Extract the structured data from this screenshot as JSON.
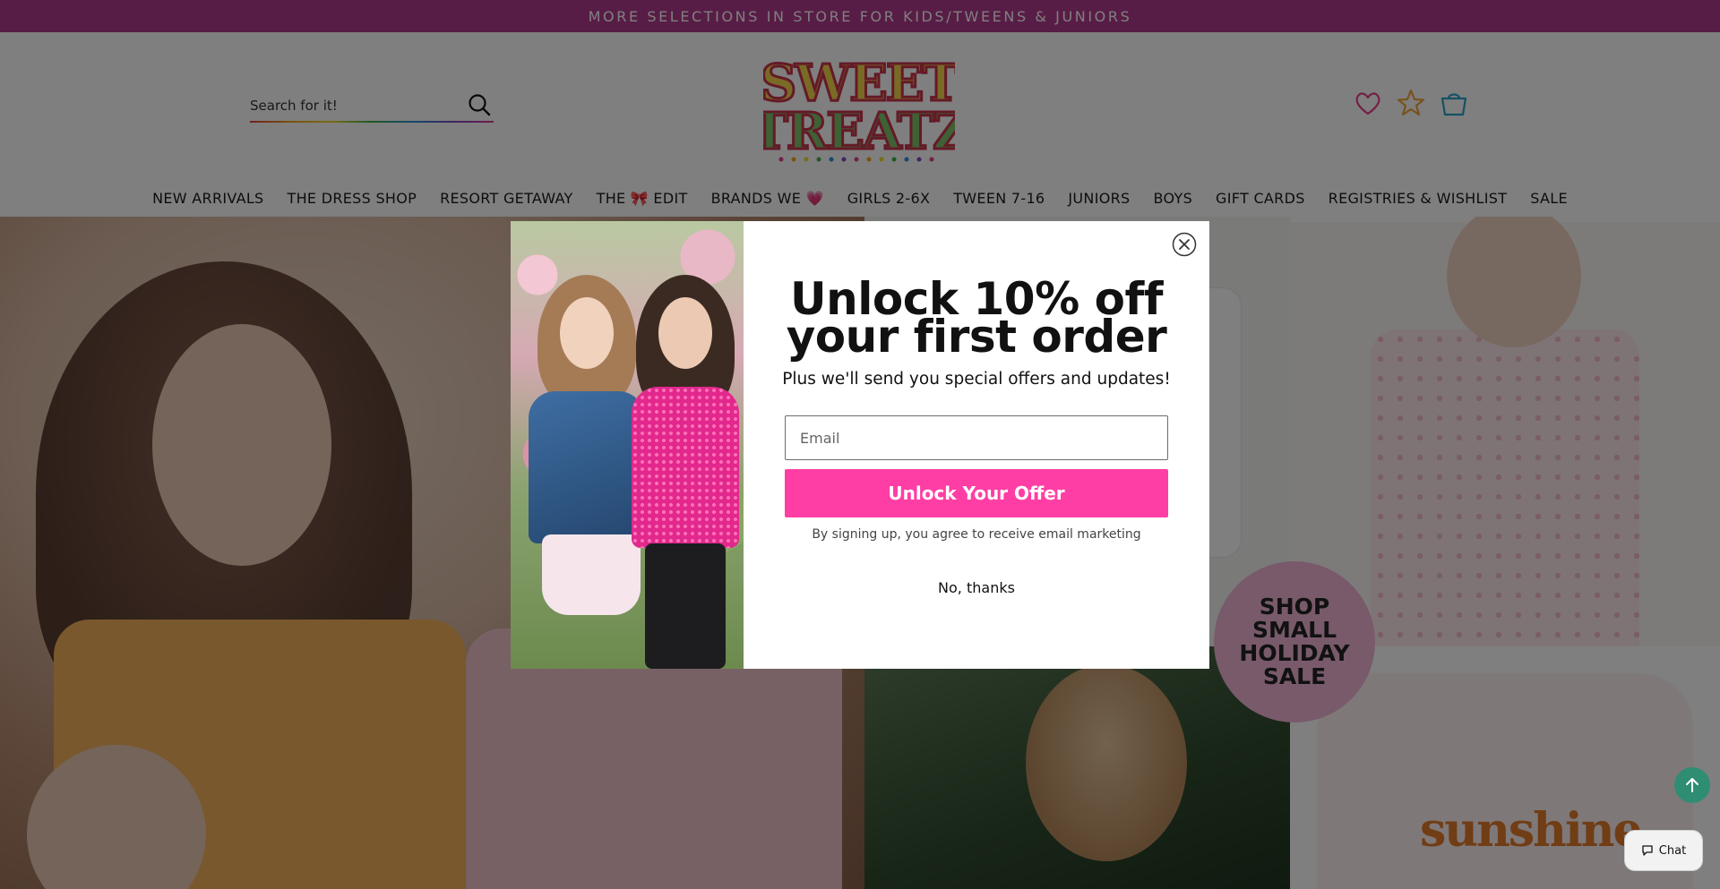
{
  "announcement": {
    "text": "MORE SELECTIONS IN STORE FOR KIDS/TWEENS & JUNIORS"
  },
  "header": {
    "search": {
      "placeholder": "Search for it!"
    },
    "logo": {
      "line1": "SWEET",
      "line2": "TREATZ"
    },
    "icons": [
      "heart-icon",
      "star-icon",
      "shopping-bag-icon"
    ]
  },
  "nav": {
    "items": [
      {
        "label": "NEW ARRIVALS"
      },
      {
        "label": "THE DRESS SHOP"
      },
      {
        "label": "RESORT GETAWAY"
      },
      {
        "label": "THE 🎀 EDIT"
      },
      {
        "label": "BRANDS WE 💗"
      },
      {
        "label": "GIRLS 2-6X"
      },
      {
        "label": "TWEEN 7-16"
      },
      {
        "label": "JUNIORS"
      },
      {
        "label": "BOYS"
      },
      {
        "label": "GIFT CARDS"
      },
      {
        "label": "REGISTRIES & WISHLIST"
      },
      {
        "label": "SALE"
      }
    ]
  },
  "hero": {
    "badge": {
      "line1": "SHOP",
      "line2": "SMALL",
      "line3": "HOLIDAY",
      "line4": "SALE"
    },
    "tee_print": "sunshine"
  },
  "popup": {
    "headline_line1": "Unlock 10% off",
    "headline_line2": "your first order",
    "subline": "Plus we'll send you special offers and updates!",
    "email": {
      "placeholder": "Email",
      "value": ""
    },
    "submit_label": "Unlock Your Offer",
    "consent": "By signing up, you agree to receive email marketing",
    "decline_label": "No, thanks"
  },
  "chat": {
    "label": "Chat"
  },
  "colors": {
    "announcement_bg": "#b03a8c",
    "cta_pink": "#ff3ea5",
    "scroll_top_green": "#2f8d74",
    "badge_pink": "#f1b4d4"
  }
}
